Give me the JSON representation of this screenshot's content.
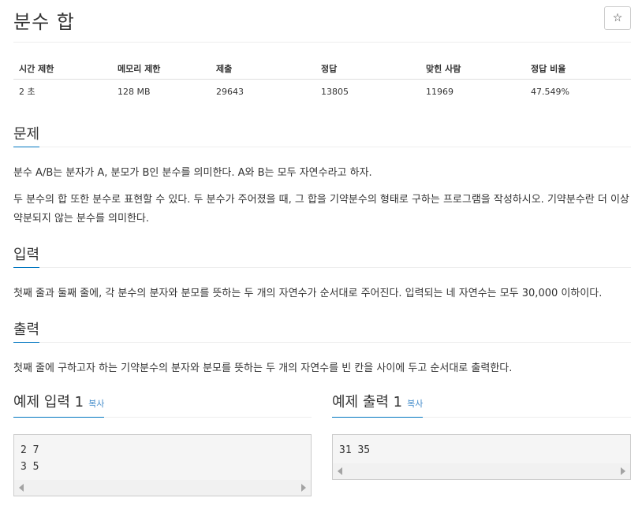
{
  "problem": {
    "title": "분수 합",
    "star_icon": "☆"
  },
  "stats": {
    "headers": [
      "시간 제한",
      "메모리 제한",
      "제출",
      "정답",
      "맞힌 사람",
      "정답 비율"
    ],
    "values": [
      "2 초",
      "128 MB",
      "29643",
      "13805",
      "11969",
      "47.549%"
    ]
  },
  "sections": {
    "problem_heading": "문제",
    "problem_p1": "분수 A/B는 분자가 A, 분모가 B인 분수를 의미한다. A와 B는 모두 자연수라고 하자.",
    "problem_p2": "두 분수의 합 또한 분수로 표현할 수 있다. 두 분수가 주어졌을 때, 그 합을 기약분수의 형태로 구하는 프로그램을 작성하시오. 기약분수란 더 이상 약분되지 않는 분수를 의미한다.",
    "input_heading": "입력",
    "input_text": "첫째 줄과 둘째 줄에, 각 분수의 분자와 분모를 뜻하는 두 개의 자연수가 순서대로 주어진다. 입력되는 네 자연수는 모두 30,000 이하이다.",
    "output_heading": "출력",
    "output_text": "첫째 줄에 구하고자 하는 기약분수의 분자와 분모를 뜻하는 두 개의 자연수를 빈 칸을 사이에 두고 순서대로 출력한다."
  },
  "examples": {
    "input_title": "예제 입력 1",
    "output_title": "예제 출력 1",
    "copy_label": "복사",
    "input_content": "2 7\n3 5",
    "output_content": "31 35"
  }
}
